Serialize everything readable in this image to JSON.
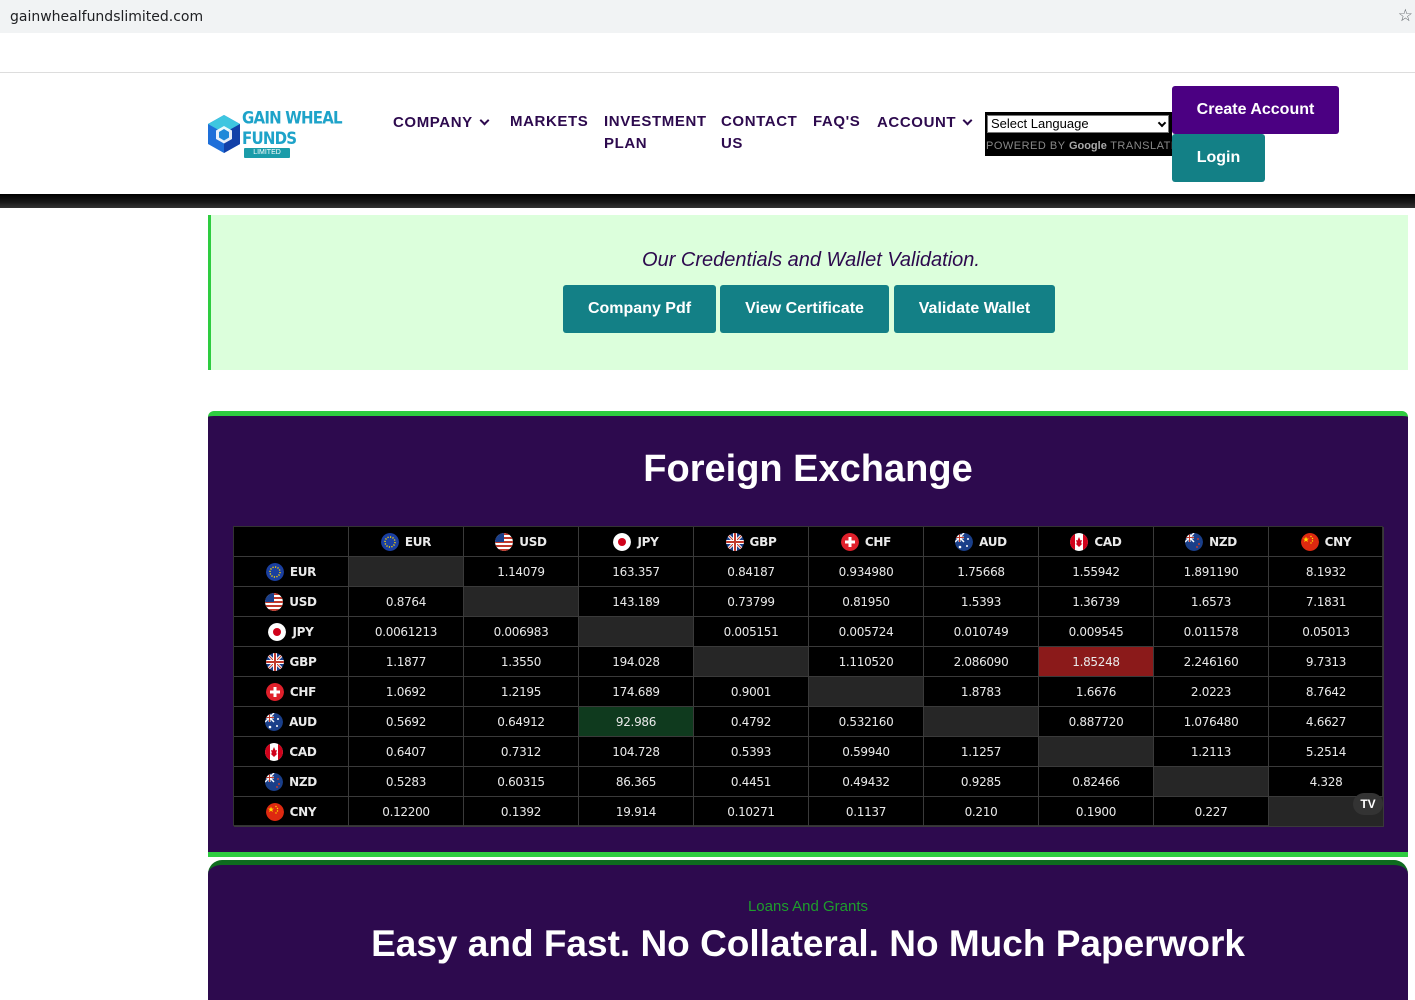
{
  "browser": {
    "url": "gainwhealfundslimited.com"
  },
  "logo": {
    "name": "GAIN WHEAL FUNDS",
    "sub": "LIMITED"
  },
  "nav": [
    {
      "label": "COMPANY",
      "dropdown": true
    },
    {
      "label": "MARKETS",
      "dropdown": false
    },
    {
      "label": "INVESTMENT PLAN",
      "dropdown": false
    },
    {
      "label": "CONTACT US",
      "dropdown": false
    },
    {
      "label": "FAQ'S",
      "dropdown": false
    },
    {
      "label": "ACCOUNT",
      "dropdown": true
    }
  ],
  "nav_lines": {
    "investment_1": "INVESTMENT",
    "investment_2": "PLAN",
    "contact_1": "CONTACT",
    "contact_2": "US"
  },
  "language": {
    "selected": "Select Language",
    "powered_by": "POWERED BY",
    "google": "Google",
    "translate": "TRANSLATE"
  },
  "auth": {
    "create": "Create Account",
    "login": "Login"
  },
  "credentials": {
    "title": "Our Credentials and Wallet Validation.",
    "buttons": [
      "Company Pdf",
      "View Certificate",
      "Validate Wallet"
    ]
  },
  "forex": {
    "title": "Foreign Exchange",
    "currencies": [
      "EUR",
      "USD",
      "JPY",
      "GBP",
      "CHF",
      "AUD",
      "CAD",
      "NZD",
      "CNY"
    ],
    "rows": [
      [
        "",
        "1.14079",
        "163.357",
        "0.84187",
        "0.934980",
        "1.75668",
        "1.55942",
        "1.891190",
        "8.1932"
      ],
      [
        "0.8764",
        "",
        "143.189",
        "0.73799",
        "0.81950",
        "1.5393",
        "1.36739",
        "1.6573",
        "7.1831"
      ],
      [
        "0.0061213",
        "0.006983",
        "",
        "0.005151",
        "0.005724",
        "0.010749",
        "0.009545",
        "0.011578",
        "0.05013"
      ],
      [
        "1.1877",
        "1.3550",
        "194.028",
        "",
        "1.110520",
        "2.086090",
        "1.85248",
        "2.246160",
        "9.7313"
      ],
      [
        "1.0692",
        "1.2195",
        "174.689",
        "0.9001",
        "",
        "1.8783",
        "1.6676",
        "2.0223",
        "8.7642"
      ],
      [
        "0.5692",
        "0.64912",
        "92.986",
        "0.4792",
        "0.532160",
        "",
        "0.887720",
        "1.076480",
        "4.6627"
      ],
      [
        "0.6407",
        "0.7312",
        "104.728",
        "0.5393",
        "0.59940",
        "1.1257",
        "",
        "1.2113",
        "5.2514"
      ],
      [
        "0.5283",
        "0.60315",
        "86.365",
        "0.4451",
        "0.49432",
        "0.9285",
        "0.82466",
        "",
        "4.328"
      ],
      [
        "0.12200",
        "0.1392",
        "19.914",
        "0.10271",
        "0.1137",
        "0.210",
        "0.1900",
        "0.227",
        ""
      ]
    ],
    "highlight_down": [
      3,
      6
    ],
    "highlight_up": [
      5,
      2
    ],
    "widget_logo": "TV"
  },
  "loans": {
    "sub": "Loans And Grants",
    "title": "Easy and Fast. No Collateral. No Much Paperwork"
  },
  "colors": {
    "purple": "#2d0a4e",
    "teal": "#138086",
    "indigo": "#4b0082",
    "green": "#2ecc40",
    "mint": "#dcffdc"
  }
}
